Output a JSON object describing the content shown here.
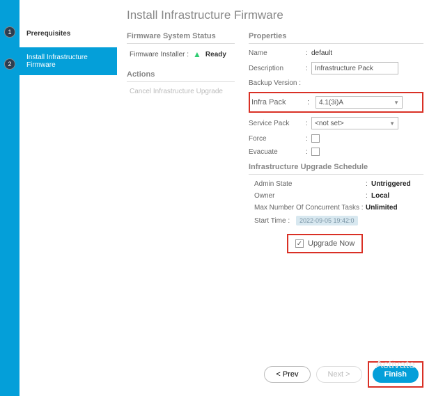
{
  "steps": {
    "step1": "1",
    "step2": "2"
  },
  "sidebar": {
    "item1": "Prerequisites",
    "item2": "Install Infrastructure Firmware"
  },
  "page_title": "Install Infrastructure Firmware",
  "left": {
    "status_head": "Firmware System Status",
    "installer_label": "Firmware Installer :",
    "installer_status": "Ready",
    "actions_head": "Actions",
    "cancel_action": "Cancel Infrastructure Upgrade"
  },
  "props": {
    "head": "Properties",
    "name_label": "Name",
    "name_val": "default",
    "desc_label": "Description",
    "desc_val": "Infrastructure Pack",
    "backup_label": "Backup Version :",
    "infra_label": "Infra Pack",
    "infra_val": "4.1(3i)A",
    "svc_label": "Service Pack",
    "svc_val": "<not set>",
    "force_label": "Force",
    "evac_label": "Evacuate"
  },
  "sched": {
    "head": "Infrastructure Upgrade Schedule",
    "admin_label": "Admin State",
    "admin_val": "Untriggered",
    "owner_label": "Owner",
    "owner_val": "Local",
    "max_label": "Max Number Of Concurrent Tasks :",
    "max_val": "Unlimited",
    "start_label": "Start Time :",
    "start_val": "2022-09-05 19:42:0",
    "upgrade_now": "Upgrade Now"
  },
  "footer": {
    "prev": "< Prev",
    "next": "Next >",
    "finish": "Finish"
  },
  "watermark": "Activate"
}
